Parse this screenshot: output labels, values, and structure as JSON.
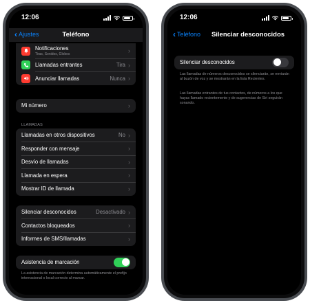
{
  "left_phone": {
    "status_time": "12:06",
    "back_label": "Ajustes",
    "title": "Teléfono",
    "notifications": {
      "label": "Notificaciones",
      "subtitle": "Tiras, Sonidos, Globos",
      "icon_color": "#ff3b30"
    },
    "incoming_calls": {
      "label": "Llamadas entrantes",
      "value": "Tira",
      "icon_color": "#30d158"
    },
    "announce_calls": {
      "label": "Anunciar llamadas",
      "value": "Nunca",
      "icon_color": "#ff3b30"
    },
    "my_number": {
      "label": "Mi número"
    },
    "calls_header": "LLAMADAS",
    "calls_rows": [
      {
        "label": "Llamadas en otros dispositivos",
        "value": "No"
      },
      {
        "label": "Responder con mensaje",
        "value": ""
      },
      {
        "label": "Desvío de llamadas",
        "value": ""
      },
      {
        "label": "Llamada en espera",
        "value": ""
      },
      {
        "label": "Mostrar ID de llamada",
        "value": ""
      }
    ],
    "block_rows": [
      {
        "label": "Silenciar desconocidos",
        "value": "Desactivado"
      },
      {
        "label": "Contactos bloqueados",
        "value": ""
      },
      {
        "label": "Informes de SMS/llamadas",
        "value": ""
      }
    ],
    "dial_assist": {
      "label": "Asistencia de marcación",
      "enabled": true,
      "footer": "La asistencia de marcación determina automáticamente el prefijo internacional o local correcto al marcar."
    }
  },
  "right_phone": {
    "status_time": "12:06",
    "back_label": "Teléfono",
    "title": "Silenciar desconocidos",
    "toggle_label": "Silenciar desconocidos",
    "enabled": false,
    "footer_1": "Las llamadas de números desconocidos se silenciarán, se enviarán al buzón de voz y se mostrarán en la lista Recientes.",
    "footer_2": "Las llamadas entrantes de tus contactos, de números a los que hayas llamado recientemente y de sugerencias de Siri seguirán sonando."
  },
  "colors": {
    "accent": "#0a84ff",
    "toggle_on": "#30d158",
    "cell_background": "#1c1c1e",
    "secondary_text": "#8e8e93"
  },
  "icons": {
    "notifications": "bell-icon",
    "incoming_calls": "phone-icon",
    "announce_calls": "speaker-icon",
    "chevron": "chevron-right-icon",
    "back": "chevron-left-icon"
  }
}
